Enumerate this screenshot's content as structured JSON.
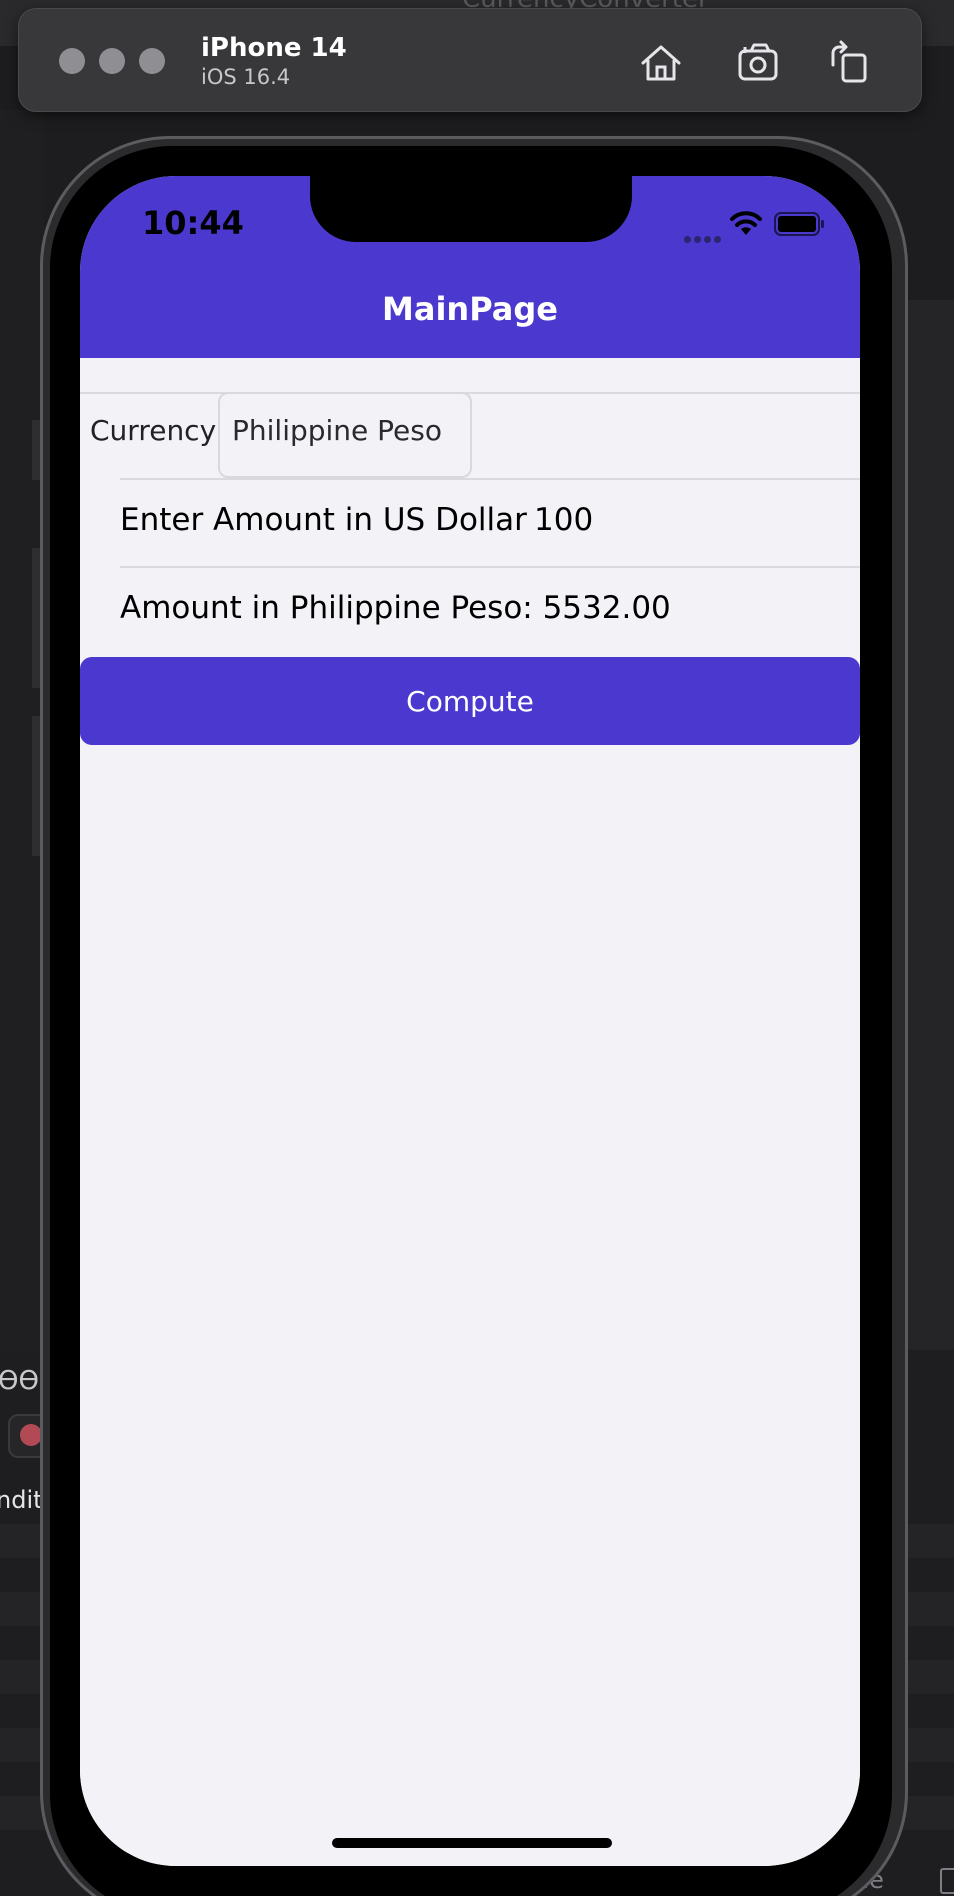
{
  "background": {
    "window_title": "CurrencyConverter",
    "debug_filter_text": "ndit",
    "console_label": "nsole"
  },
  "simulator": {
    "device_name": "iPhone 14",
    "os_version": "iOS 16.4",
    "toolbar_icons": [
      "home-icon",
      "screenshot-icon",
      "rotate-icon"
    ]
  },
  "status_bar": {
    "time": "10:44"
  },
  "nav": {
    "title": "MainPage"
  },
  "form": {
    "currency_label": "Currency",
    "currency_value": "Philippine Peso",
    "amount_label": "Enter Amount in US Dollar",
    "amount_value": "100",
    "result_text": "Amount in Philippine Peso: 5532.00"
  },
  "compute_button": {
    "label": "Compute"
  },
  "colors": {
    "accent": "#4a38cf",
    "page_background": "#f2f2f7",
    "separator": "#d9d9de"
  }
}
